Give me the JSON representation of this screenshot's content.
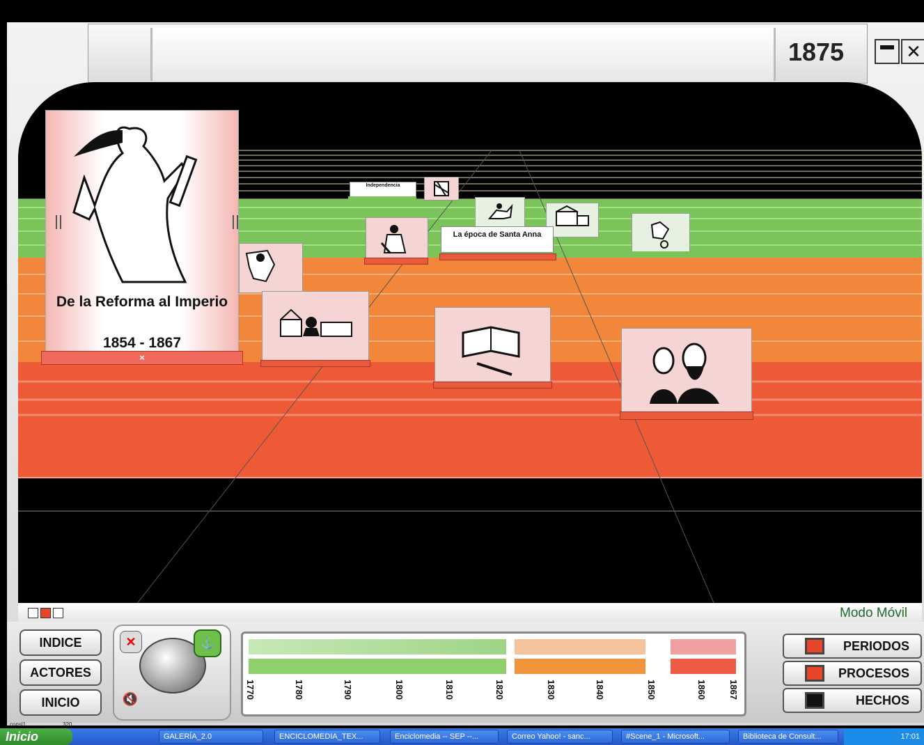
{
  "window": {
    "year": "1875",
    "minimize_icon": "minimize-icon",
    "close_icon": "close-icon"
  },
  "scene": {
    "period_card": {
      "title": "De la Reforma al Imperio",
      "years": "1854 - 1867",
      "close_mark": "×",
      "icon": "allegory-woman-with-tablet-icon"
    },
    "labels": {
      "independencia": "Independencia",
      "santa_anna": "La época de Santa Anna"
    },
    "cards": [
      {
        "icon": "scroll-document-icon"
      },
      {
        "icon": "map-figure-icon"
      },
      {
        "icon": "soldier-icon"
      },
      {
        "icon": "battle-icon"
      },
      {
        "icon": "buildings-icon"
      },
      {
        "icon": "horseman-icon"
      },
      {
        "icon": "cathedral-and-portrait-icon"
      },
      {
        "icon": "book-and-pen-icon"
      },
      {
        "icon": "maximilian-and-carlota-icon"
      }
    ],
    "mode_label": "Modo Móvil"
  },
  "controls": {
    "nav": [
      "INDICE",
      "ACTORES",
      "INICIO"
    ],
    "joystick_icons": [
      "x-icon",
      "anchor-icon",
      "sound-mute-icon"
    ],
    "filters": [
      {
        "label": "PERIODOS",
        "color": "#e8452a"
      },
      {
        "label": "PROCESOS",
        "color": "#e8452a"
      },
      {
        "label": "HECHOS",
        "color": "#111111"
      }
    ]
  },
  "timeline": {
    "ticks": [
      "1770",
      "1780",
      "1790",
      "1800",
      "1810",
      "1820",
      "1830",
      "1840",
      "1850",
      "1860",
      "1867"
    ],
    "status_left": "consl1",
    "status_right": "320"
  },
  "taskbar": {
    "start": "Inicio",
    "tasks": [
      "GALERÍA_2.0",
      "ENCICLOMEDIA_TEX...",
      "Enciclomedia -- SEP --...",
      "Correo Yahoo! - sanc...",
      "#Scene_1 - Microsoft...",
      "Biblioteca de Consult..."
    ],
    "clock": "17:01"
  }
}
